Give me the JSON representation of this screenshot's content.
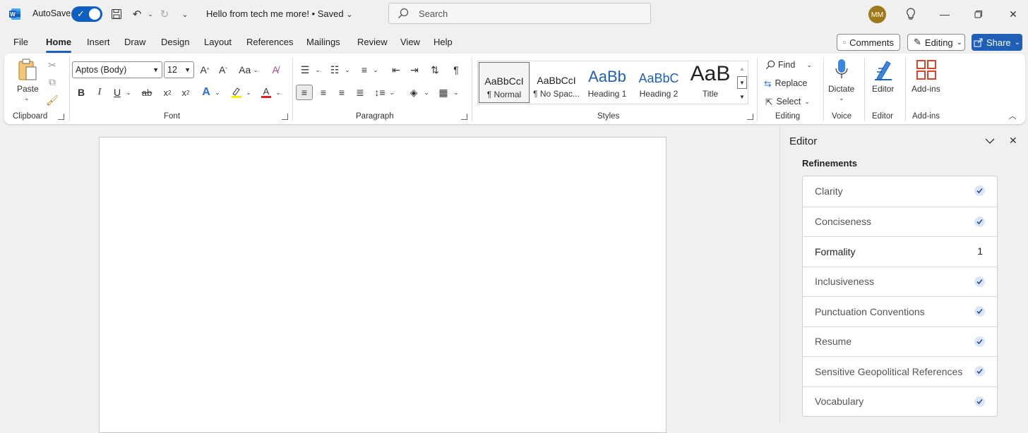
{
  "titlebar": {
    "autosave_label": "AutoSave",
    "doc_title": "Hello from tech me more!  •  Saved",
    "search_placeholder": "Search",
    "avatar_initials": "MM"
  },
  "menu": {
    "tabs": [
      "File",
      "Home",
      "Insert",
      "Draw",
      "Design",
      "Layout",
      "References",
      "Mailings",
      "Review",
      "View",
      "Help"
    ],
    "active_tab": "Home",
    "comments_label": "Comments",
    "editing_label": "Editing",
    "share_label": "Share"
  },
  "ribbon": {
    "clipboard": {
      "paste_label": "Paste",
      "group_label": "Clipboard"
    },
    "font": {
      "font_name": "Aptos (Body)",
      "font_size": "12",
      "case_label": "Aa",
      "group_label": "Font"
    },
    "paragraph": {
      "group_label": "Paragraph"
    },
    "styles": {
      "group_label": "Styles",
      "items": [
        {
          "sample": "AaBbCcI",
          "name": "¶ Normal"
        },
        {
          "sample": "AaBbCcI",
          "name": "¶ No Spac..."
        },
        {
          "sample": "AaBb",
          "name": "Heading 1"
        },
        {
          "sample": "AaBbC",
          "name": "Heading 2"
        },
        {
          "sample": "AaB",
          "name": "Title"
        }
      ]
    },
    "editing": {
      "find_label": "Find",
      "replace_label": "Replace",
      "select_label": "Select",
      "group_label": "Editing"
    },
    "voice": {
      "dictate_label": "Dictate",
      "group_label": "Voice"
    },
    "editor": {
      "editor_label": "Editor",
      "group_label": "Editor"
    },
    "addins": {
      "addins_label": "Add-ins",
      "group_label": "Add-ins"
    }
  },
  "editor_pane": {
    "title": "Editor",
    "refinements_heading": "Refinements",
    "items": [
      {
        "label": "Clarity",
        "status": "check"
      },
      {
        "label": "Conciseness",
        "status": "check"
      },
      {
        "label": "Formality",
        "status": "count",
        "count": "1"
      },
      {
        "label": "Inclusiveness",
        "status": "check"
      },
      {
        "label": "Punctuation Conventions",
        "status": "check"
      },
      {
        "label": "Resume",
        "status": "check"
      },
      {
        "label": "Sensitive Geopolitical References",
        "status": "check"
      },
      {
        "label": "Vocabulary",
        "status": "check"
      }
    ]
  },
  "colors": {
    "accent": "#1f5fb6",
    "background": "#f0f0f0",
    "avatar": "#a0781c"
  }
}
